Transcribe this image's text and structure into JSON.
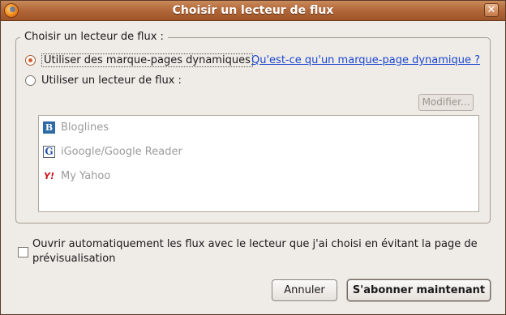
{
  "window": {
    "title": "Choisir un lecteur de flux",
    "close_symbol": "✕"
  },
  "frame": {
    "legend": "Choisir un lecteur de flux  :"
  },
  "options": {
    "dynamic": {
      "label": "Utiliser des marque-pages dynamiques",
      "checked": true
    },
    "dynamic_help_link": "Qu'est-ce qu'un marque-page dynamique  ?",
    "reader": {
      "label": "Utiliser un lecteur de flux :",
      "checked": false
    }
  },
  "modify_button": "Modifier...",
  "readers": [
    {
      "name": "Bloglines",
      "icon": "bloglines-icon",
      "glyph": "B"
    },
    {
      "name": "iGoogle/Google Reader",
      "icon": "google-icon",
      "glyph": "G"
    },
    {
      "name": "My Yahoo",
      "icon": "yahoo-icon",
      "glyph": "Y!"
    }
  ],
  "auto_open": {
    "checked": false,
    "label": "Ouvrir automatiquement les flux avec le lecteur que j'ai choisi en évitant la page de prévisualisation"
  },
  "buttons": {
    "cancel": "Annuler",
    "subscribe": "S'abonner maintenant"
  }
}
